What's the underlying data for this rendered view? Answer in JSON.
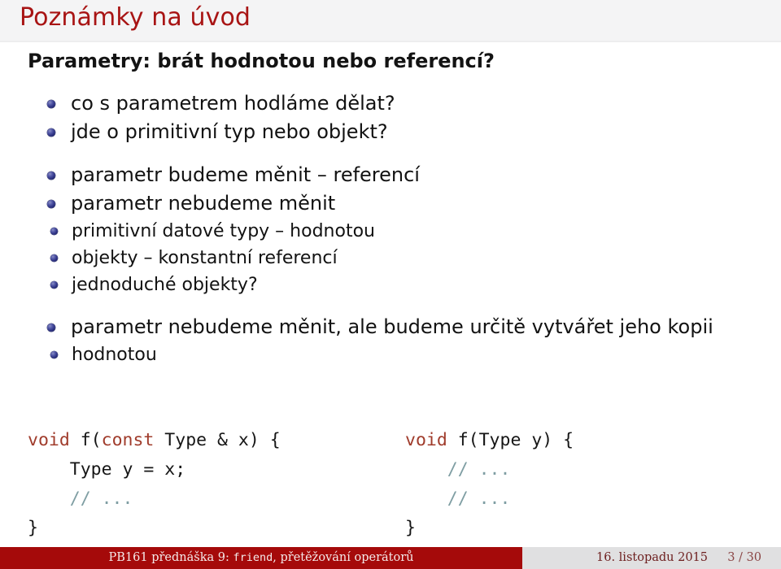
{
  "slide": {
    "title": "Poznámky na úvod",
    "heading": "Parametry: brát hodnotou nebo referencí?",
    "group_one": [
      {
        "text": "co s parametrem hodláme dělat?"
      },
      {
        "text": "jde o primitivní typ nebo objekt?"
      }
    ],
    "group_two": [
      {
        "text": "parametr budeme měnit – referencí"
      },
      {
        "text": "parametr nebudeme měnit"
      }
    ],
    "group_two_sub": [
      {
        "text": "primitivní datové typy – hodnotou"
      },
      {
        "text": "objekty – konstantní referencí"
      },
      {
        "text": "jednoduché objekty?"
      }
    ],
    "group_three": [
      {
        "text": "parametr nebudeme měnit, ale budeme určitě vytvářet jeho kopii"
      }
    ],
    "group_three_sub": [
      {
        "text": "hodnotou"
      }
    ]
  },
  "code": {
    "left": {
      "line1_kw": "void",
      "line1_a": " f(",
      "line1_kw2": "const",
      "line1_b": " Type & x) {",
      "line2": "    Type y = x;",
      "line3_cmt": "    // ...",
      "line4": "}"
    },
    "right": {
      "line1_kw": "void",
      "line1_a": " f(Type y) {",
      "line2_cmt": "    // ...",
      "line3_cmt": "    // ...",
      "line4": "}"
    }
  },
  "footer": {
    "course_prefix": "PB161 přednáška 9: ",
    "course_mono": "friend",
    "course_suffix": ", přetěžování operátorů",
    "date": "16. listopadu 2015",
    "page": "3 / 30"
  },
  "colors": {
    "title_red": "#a81414",
    "title_bar_bg": "#f4f4f5",
    "footer_red": "#a50a0a",
    "footer_bg": "#e0e0e1",
    "bullet_blue": "#2b3080",
    "code_keyword": "#a03c2c",
    "code_comment": "#7f9ea3",
    "body_text": "#121212"
  }
}
